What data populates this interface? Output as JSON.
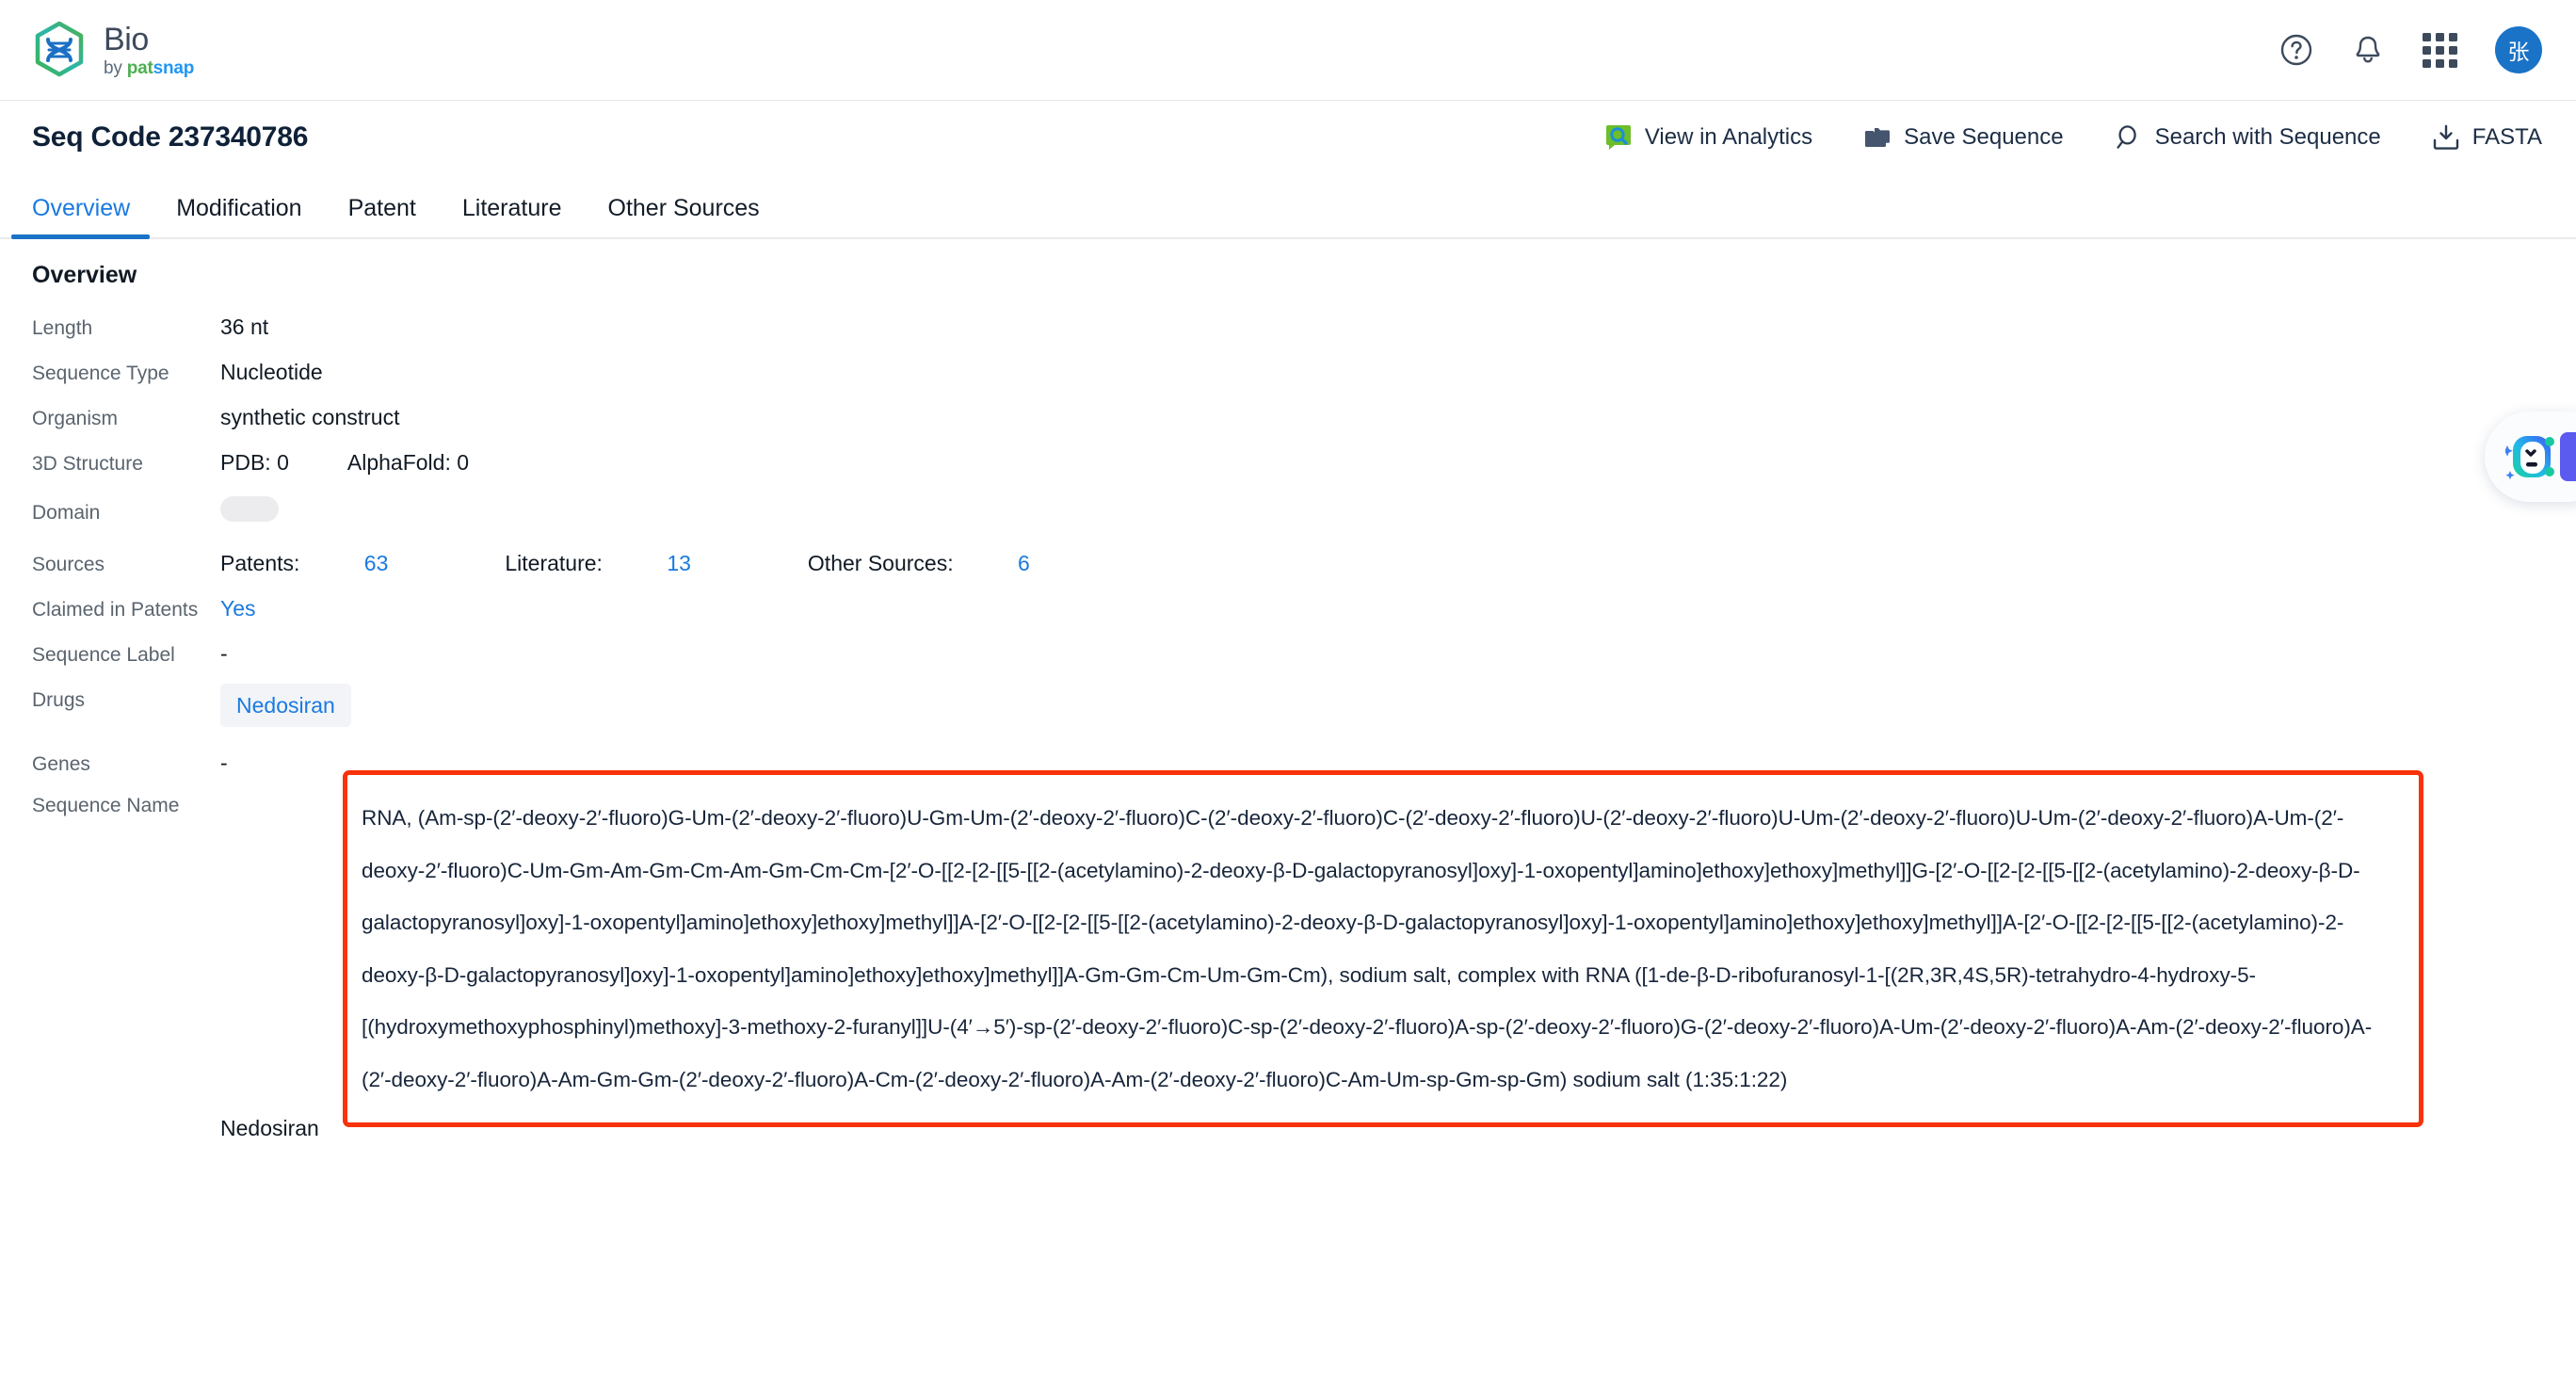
{
  "brand": {
    "title": "Bio",
    "by": "by ",
    "pat": "pat",
    "snap": "snap"
  },
  "topbar": {
    "help_icon": "help-circle-icon",
    "bell_icon": "notification-bell-icon",
    "apps_icon": "apps-grid-icon",
    "avatar_initial": "张"
  },
  "header": {
    "title": "Seq Code 237340786",
    "actions": [
      {
        "label": "View in Analytics",
        "icon": "analytics-search-icon"
      },
      {
        "label": "Save Sequence",
        "icon": "folders-icon"
      },
      {
        "label": "Search with Sequence",
        "icon": "magnifier-icon"
      },
      {
        "label": "FASTA",
        "icon": "download-icon"
      }
    ]
  },
  "tabs": [
    {
      "label": "Overview",
      "active": true
    },
    {
      "label": "Modification",
      "active": false
    },
    {
      "label": "Patent",
      "active": false
    },
    {
      "label": "Literature",
      "active": false
    },
    {
      "label": "Other Sources",
      "active": false
    }
  ],
  "overview": {
    "section_title": "Overview",
    "length_label": "Length",
    "length_value": "36 nt",
    "sequence_type_label": "Sequence Type",
    "sequence_type_value": "Nucleotide",
    "organism_label": "Organism",
    "organism_value": "synthetic construct",
    "structure_label": "3D Structure",
    "structure_pdb": "PDB: 0",
    "structure_alphafold": "AlphaFold: 0",
    "domain_label": "Domain",
    "sources_label": "Sources",
    "sources_patents_text": "Patents: ",
    "sources_patents_count": "63",
    "sources_literature_text": "Literature: ",
    "sources_literature_count": "13",
    "sources_other_text": "Other Sources: ",
    "sources_other_count": "6",
    "claimed_label": "Claimed in Patents",
    "claimed_value": "Yes",
    "sequence_label_label": "Sequence Label",
    "sequence_label_value": "-",
    "drugs_label": "Drugs",
    "drugs_chip": "Nedosiran",
    "genes_label": "Genes",
    "genes_value": "-",
    "sequence_name_label": "Sequence Name",
    "sequence_name_value": "RNA, (Am-sp-(2′-deoxy-2′-fluoro)G-Um-(2′-deoxy-2′-fluoro)U-Gm-Um-(2′-deoxy-2′-fluoro)C-(2′-deoxy-2′-fluoro)C-(2′-deoxy-2′-fluoro)U-(2′-deoxy-2′-fluoro)U-Um-(2′-deoxy-2′-fluoro)U-Um-(2′-deoxy-2′-fluoro)A-Um-(2′-deoxy-2′-fluoro)C-Um-Gm-Am-Gm-Cm-Am-Gm-Cm-Cm-[2′-O-[[2-[2-[[5-[[2-(acetylamino)-2-deoxy-β-D-galactopyranosyl]oxy]-1-oxopentyl]amino]ethoxy]ethoxy]methyl]]G-[2′-O-[[2-[2-[[5-[[2-(acetylamino)-2-deoxy-β-D-galactopyranosyl]oxy]-1-oxopentyl]amino]ethoxy]ethoxy]methyl]]A-[2′-O-[[2-[2-[[5-[[2-(acetylamino)-2-deoxy-β-D-galactopyranosyl]oxy]-1-oxopentyl]amino]ethoxy]ethoxy]methyl]]A-[2′-O-[[2-[2-[[5-[[2-(acetylamino)-2-deoxy-β-D-galactopyranosyl]oxy]-1-oxopentyl]amino]ethoxy]ethoxy]methyl]]A-Gm-Gm-Cm-Um-Gm-Cm), sodium salt, complex with RNA ([1-de-β-D-ribofuranosyl-1-[(2R,3R,4S,5R)-tetrahydro-4-hydroxy-5-[(hydroxymethoxyphosphinyl)methoxy]-3-methoxy-2-furanyl]]U-(4′→5′)-sp-(2′-deoxy-2′-fluoro)C-sp-(2′-deoxy-2′-fluoro)A-sp-(2′-deoxy-2′-fluoro)G-(2′-deoxy-2′-fluoro)A-Um-(2′-deoxy-2′-fluoro)A-Am-(2′-deoxy-2′-fluoro)A-(2′-deoxy-2′-fluoro)A-Am-Gm-Gm-(2′-deoxy-2′-fluoro)A-Cm-(2′-deoxy-2′-fluoro)A-Am-(2′-deoxy-2′-fluoro)C-Am-Um-sp-Gm-sp-Gm) sodium salt (1:35:1:22)",
    "below_sequence_text": "Nedosiran"
  },
  "colors": {
    "accent_blue": "#1a73c7",
    "link_blue": "#1a7ae0",
    "annotation_red": "#f8320a",
    "text_dark": "#111a24",
    "label_gray": "#5a646e"
  }
}
